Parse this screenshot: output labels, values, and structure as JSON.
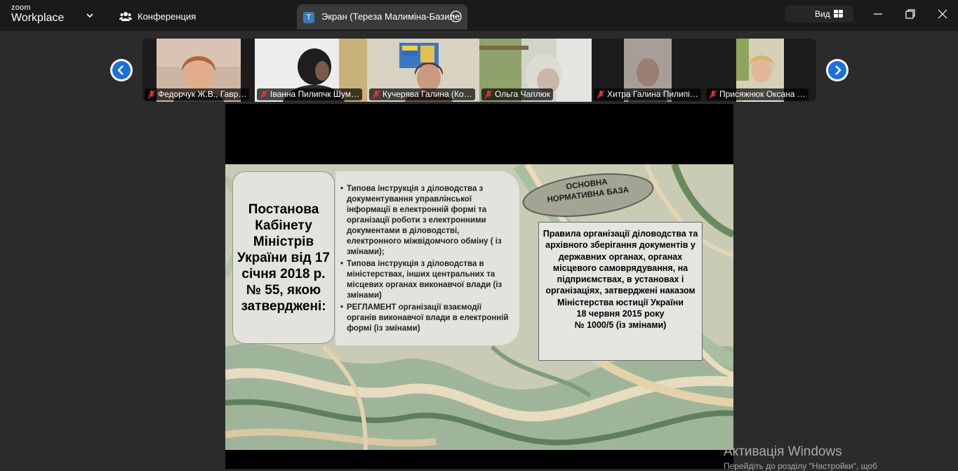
{
  "app": {
    "brand_top": "zoom",
    "brand_bottom": "Workplace"
  },
  "header": {
    "conference_label": "Конференция",
    "tab_icon_letter": "T",
    "tab_label": "Экран (Тереза Малиміна-Базиле",
    "view_label": "Вид",
    "colors": {
      "bar": "#1a1a1a",
      "tab": "#3a3a3a",
      "shield": "#23b14d"
    }
  },
  "gallery": {
    "participants": [
      {
        "name": "Федорчук Ж.В., Гавр…"
      },
      {
        "name": "Іванна Пилипчк Шум…"
      },
      {
        "name": "Кучерява Галина (Ко…"
      },
      {
        "name": "Ольга Чаплюк"
      },
      {
        "name": "Хитра Галина Пилипі…"
      },
      {
        "name": "Присяжнюк Оксана …"
      }
    ],
    "muted_color": "#e0333a",
    "nav_color": "#1a6fe0"
  },
  "slide": {
    "left_box": "Постанова Кабінету Міністрів України від 17 січня 2018 р. № 55, якою затверджені:",
    "bullets": [
      "Типова інструкція з діловодства з документування управлінської інформації в електронній формі та організації роботи з електронними документами в діловодстві, електронного міжвідомчого обміну ( із змінами);",
      "Типова інструкція з діловодства в міністерствах, інших центральних  та місцевих органах  виконавчої влади (із змінами)",
      "РЕГЛАМЕНТ організації взаємодії органів виконавчої влади в електронній формі (із змінами)"
    ],
    "oval_line1": "ОСНОВНА",
    "oval_line2": "НОРМАТИВНА БАЗА",
    "right_box": "Правила організації діловодства та архівного зберігання документів у державних органах, органах місцевого самоврядування, на підприємствах, в установах і організаціях, затверджені наказом Міністерства юстиції України",
    "right_date": "18 червня 2015 року",
    "right_number": "№ 1000/5 (із змінами)"
  },
  "watermark": {
    "line1": "Активація Windows",
    "line2": "Перейдіть до розділу \"Настройки\", щоб"
  }
}
